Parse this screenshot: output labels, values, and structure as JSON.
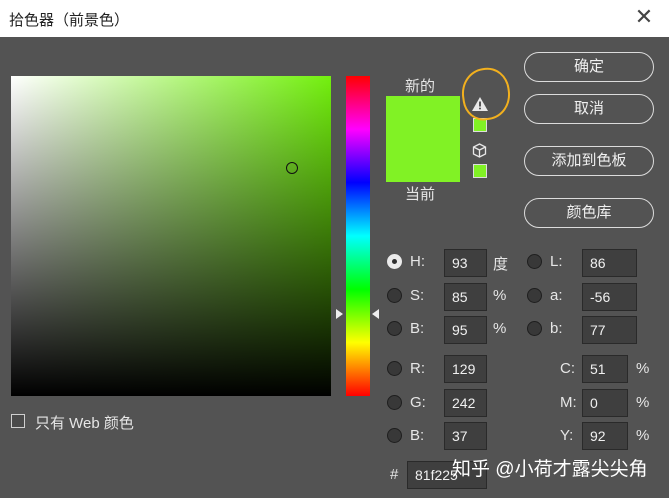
{
  "window": {
    "title": "拾色器（前景色）",
    "close_glyph": "✕"
  },
  "picker": {
    "current_hex": "#81f225"
  },
  "swatches": {
    "new_label": "新的",
    "current_label": "当前"
  },
  "buttons": {
    "ok": "确定",
    "cancel": "取消",
    "add_to_swatches": "添加到色板",
    "color_libraries": "颜色库"
  },
  "hsb": {
    "h": {
      "label": "H:",
      "value": "93",
      "unit": "度"
    },
    "s": {
      "label": "S:",
      "value": "85",
      "unit": "%"
    },
    "b": {
      "label": "B:",
      "value": "95",
      "unit": "%"
    }
  },
  "rgb": {
    "r": {
      "label": "R:",
      "value": "129"
    },
    "g": {
      "label": "G:",
      "value": "242"
    },
    "b": {
      "label": "B:",
      "value": "37"
    }
  },
  "lab": {
    "l": {
      "label": "L:",
      "value": "86"
    },
    "a": {
      "label": "a:",
      "value": "-56"
    },
    "b": {
      "label": "b:",
      "value": "77"
    }
  },
  "cmyk": {
    "c": {
      "label": "C:",
      "value": "51",
      "unit": "%"
    },
    "m": {
      "label": "M:",
      "value": "0",
      "unit": "%"
    },
    "y": {
      "label": "Y:",
      "value": "92",
      "unit": "%"
    }
  },
  "hex": {
    "label": "#",
    "value": "81f225"
  },
  "web_only": {
    "label": "只有 Web 颜色"
  },
  "watermark": "知乎 @小荷才露尖尖角",
  "colors": {
    "accent": "#81f225",
    "annotation": "#f2b01e",
    "background": "#535353"
  }
}
